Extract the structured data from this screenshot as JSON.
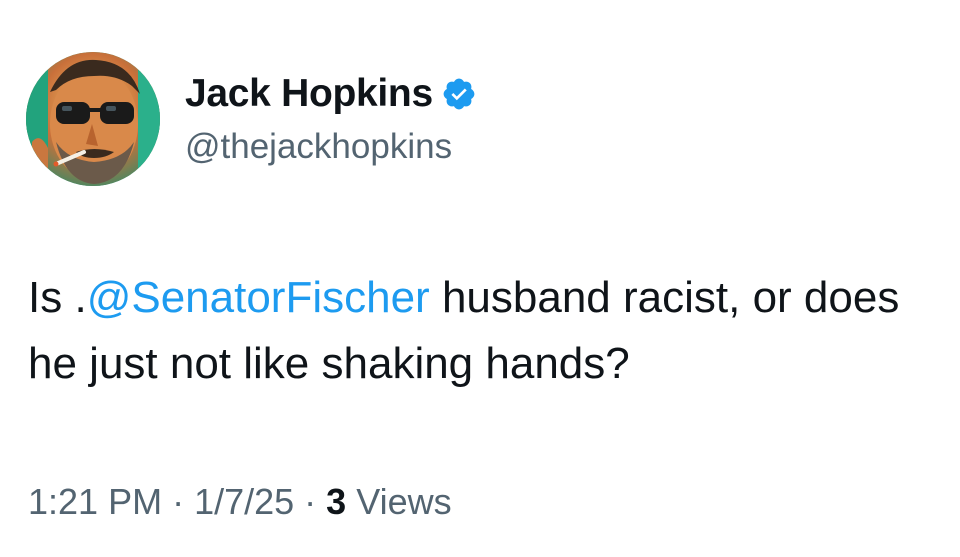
{
  "author": {
    "display_name": "Jack Hopkins",
    "handle": "@thejackhopkins",
    "verified": true,
    "verified_icon": "verified-badge-icon",
    "verified_color": "#1d9bf0",
    "avatar_icon": "profile-photo"
  },
  "tweet": {
    "prefix": "Is .",
    "mention": "@SenatorFischer",
    "suffix": " husband racist, or does he just not like shaking hands?",
    "mention_color": "#1d9bf0"
  },
  "meta": {
    "time": "1:21 PM",
    "separator1": " · ",
    "date": "1/7/25",
    "separator2": " · ",
    "views_count": "3",
    "views_label": " Views"
  }
}
